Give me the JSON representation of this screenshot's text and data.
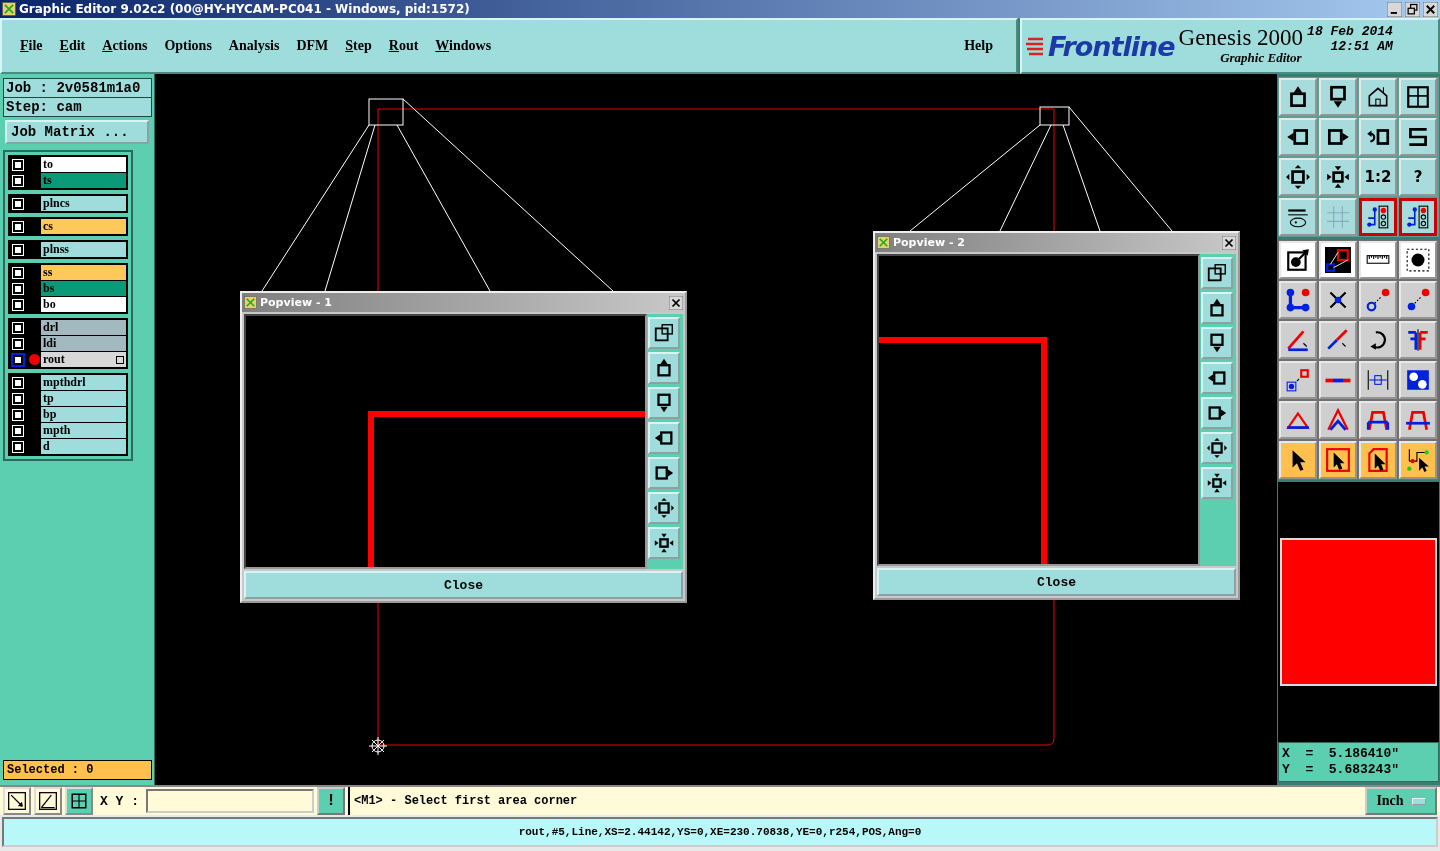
{
  "window": {
    "title": "Graphic Editor 9.02c2 (00@HY-HYCAM-PC041 - Windows, pid:1572)"
  },
  "menu": [
    {
      "label": "File",
      "underlined": true
    },
    {
      "label": "Edit",
      "underlined": true
    },
    {
      "label": "Actions",
      "underlined": true
    },
    {
      "label": "Options",
      "underlined": false
    },
    {
      "label": "Analysis",
      "underlined": false
    },
    {
      "label": "DFM",
      "underlined": false
    },
    {
      "label": "Step",
      "underlined": true
    },
    {
      "label": "Rout",
      "underlined": true
    },
    {
      "label": "Windows",
      "underlined": true
    },
    {
      "label": "Help",
      "underlined": false
    }
  ],
  "branding": {
    "logo": "Frontline",
    "product": "Genesis 2000",
    "subtitle": "Graphic Editor",
    "date": "18 Feb 2014",
    "time": "12:51 AM"
  },
  "job": {
    "job": "Job : 2v0581m1a0",
    "step": "Step: cam",
    "matrix_button": "Job Matrix ..."
  },
  "layer_groups": [
    {
      "layers": [
        {
          "name": "to",
          "color": "#ffffff",
          "checked": false,
          "selected": false
        },
        {
          "name": "ts",
          "color": "#0b9a77",
          "checked": false,
          "selected": false
        }
      ]
    },
    {
      "layers": [
        {
          "name": "plncs",
          "color": "#a0dcdc",
          "checked": false,
          "selected": false
        }
      ]
    },
    {
      "layers": [
        {
          "name": "cs",
          "color": "#ffc85a",
          "checked": false,
          "selected": false
        }
      ]
    },
    {
      "layers": [
        {
          "name": "plnss",
          "color": "#a0dcdc",
          "checked": false,
          "selected": false
        }
      ]
    },
    {
      "layers": [
        {
          "name": "ss",
          "color": "#ffc85a",
          "checked": false,
          "selected": false
        },
        {
          "name": "bs",
          "color": "#0b9a77",
          "checked": false,
          "selected": false
        },
        {
          "name": "bo",
          "color": "#ffffff",
          "checked": false,
          "selected": false
        }
      ]
    },
    {
      "layers": [
        {
          "name": "drl",
          "color": "#a3b9c0",
          "checked": false,
          "selected": false
        },
        {
          "name": "ldi",
          "color": "#a3b9c0",
          "checked": false,
          "selected": false
        },
        {
          "name": "rout",
          "color": "#d8d8d8",
          "checked": false,
          "selected": true
        }
      ]
    },
    {
      "layers": [
        {
          "name": "mpthdrl",
          "color": "#a0dcdc",
          "checked": false,
          "selected": false
        },
        {
          "name": "tp",
          "color": "#a0dcdc",
          "checked": false,
          "selected": false
        },
        {
          "name": "bp",
          "color": "#a0dcdc",
          "checked": false,
          "selected": false
        },
        {
          "name": "mpth",
          "color": "#a0dcdc",
          "checked": false,
          "selected": false
        },
        {
          "name": "d",
          "color": "#a0dcdc",
          "checked": false,
          "selected": false
        }
      ]
    }
  ],
  "selected_count": "Selected : 0",
  "popviews": [
    {
      "title": "Popview - 1",
      "close": "Close"
    },
    {
      "title": "Popview - 2",
      "close": "Close"
    }
  ],
  "toolbar_labels": {
    "ratio": "1:2",
    "help": "?"
  },
  "coordinates": {
    "x": "X  =  5.186410\"",
    "y": "Y  =  5.683243\""
  },
  "command_bar": {
    "xy_label": "X Y :",
    "alert": "!",
    "prompt": "<M1> - Select first area corner",
    "units": "Inch"
  },
  "status_bar": "rout,#5,Line,XS=2.44142,YS=0,XE=230.70838,YE=0,r254,POS,Ang=0"
}
